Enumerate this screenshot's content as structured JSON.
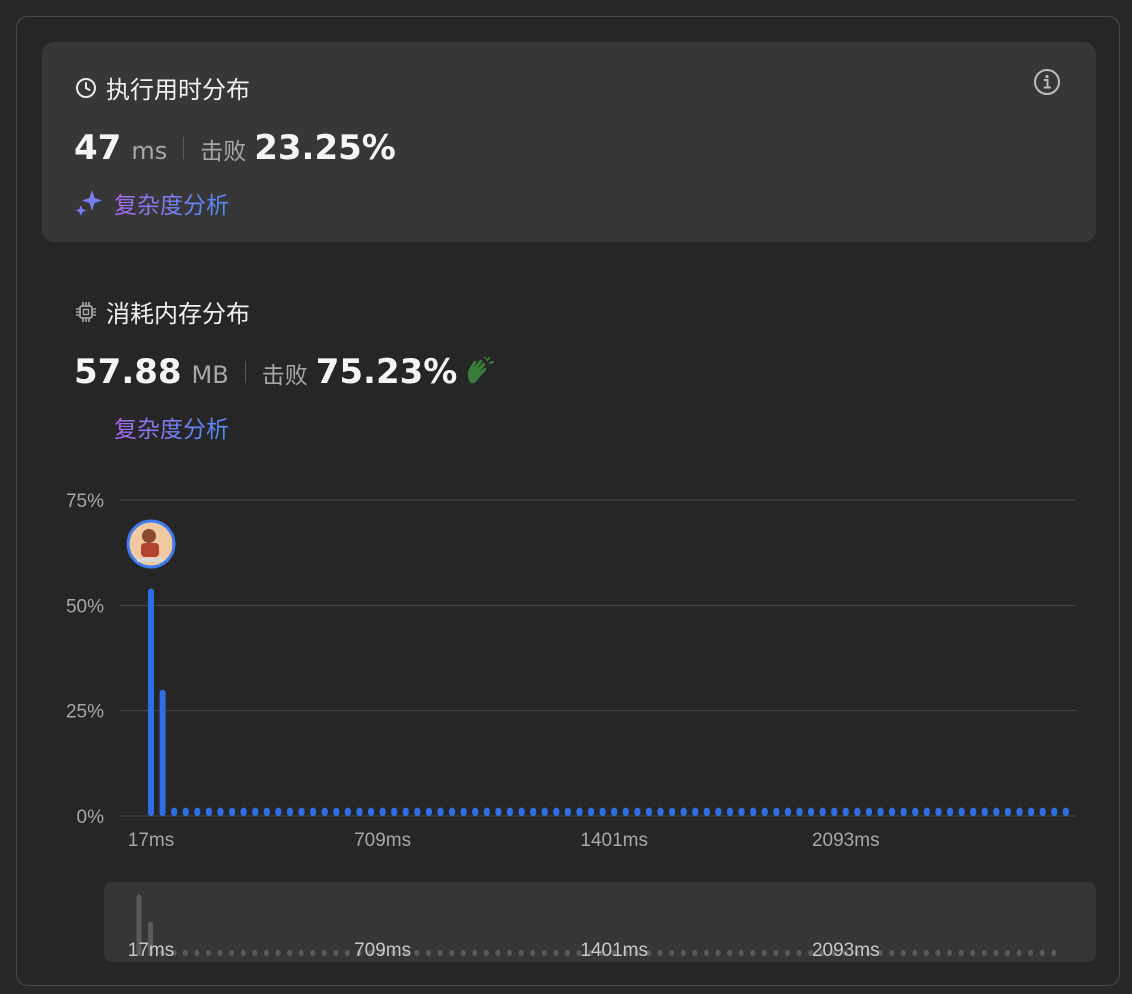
{
  "runtime": {
    "title": "执行用时分布",
    "value": "47",
    "unit": "ms",
    "beats_label": "击败",
    "beats_percent": "23.25%",
    "complexity_link": "复杂度分析"
  },
  "memory": {
    "title": "消耗内存分布",
    "value": "57.88",
    "unit": "MB",
    "beats_label": "击败",
    "beats_percent": "75.23%",
    "complexity_link": "复杂度分析"
  },
  "icons": {
    "runtime": "clock-icon",
    "info": "info-icon",
    "sparkle": "sparkle-icon",
    "memory": "chip-icon",
    "clap": "clapping-hands-icon",
    "avatar": "user-avatar"
  },
  "colors": {
    "bar": "#2f6fe6",
    "minimap_bar": "#5a5a5a",
    "grid": "#4a4a4a",
    "accent_purple": "#a46bf0",
    "accent_blue": "#4f8cf6",
    "clap_green": "#3a7d3a"
  },
  "chart_data": {
    "type": "bar",
    "ylabel": "",
    "xlabel": "",
    "ylim": [
      0,
      75
    ],
    "yticks": [
      "0%",
      "25%",
      "50%",
      "75%"
    ],
    "ytick_values": [
      0,
      25,
      50,
      75
    ],
    "xticks": [
      "17ms",
      "709ms",
      "1401ms",
      "2093ms"
    ],
    "xtick_values": [
      17,
      709,
      1401,
      2093
    ],
    "x_start": 17,
    "bin_width_ms": 34.6,
    "bin_count": 80,
    "values": [
      54,
      30,
      2,
      2,
      2,
      2,
      2,
      2,
      2,
      2,
      2,
      2,
      2,
      2,
      2,
      2,
      2,
      2,
      2,
      2,
      2,
      2,
      2,
      2,
      2,
      2,
      2,
      2,
      2,
      2,
      2,
      2,
      2,
      2,
      2,
      2,
      2,
      2,
      2,
      2,
      2,
      2,
      2,
      2,
      2,
      2,
      2,
      2,
      2,
      2,
      2,
      2,
      2,
      2,
      2,
      2,
      2,
      2,
      2,
      2,
      2,
      2,
      2,
      2,
      2,
      2,
      2,
      2,
      2,
      2,
      2,
      2,
      2,
      2,
      2,
      2,
      2,
      2,
      2,
      2
    ],
    "highlight_bin": 0
  }
}
